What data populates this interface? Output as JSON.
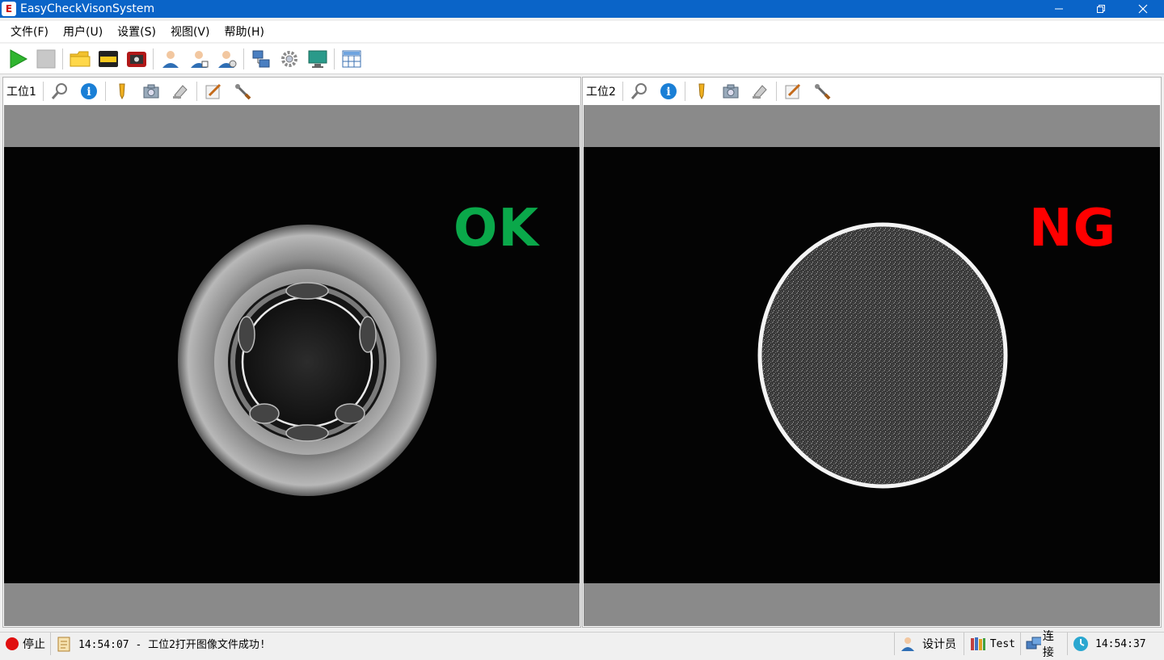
{
  "window": {
    "title": "EasyCheckVisonSystem",
    "logo_text": "E"
  },
  "menu": [
    {
      "label": "文件(F)"
    },
    {
      "label": "用户(U)"
    },
    {
      "label": "设置(S)"
    },
    {
      "label": "视图(V)"
    },
    {
      "label": "帮助(H)"
    }
  ],
  "toolbar": {
    "icons": [
      "play-icon",
      "stop-icon",
      "open-folder-icon",
      "save-icon",
      "camera-record-icon",
      "user-login-icon",
      "user-manage-icon",
      "user-settings-icon",
      "network-icon",
      "gear-icon",
      "monitor-icon",
      "grid-layout-icon"
    ]
  },
  "panels": [
    {
      "label": "工位1",
      "result": "OK",
      "result_color": "#0aa84a",
      "tools": [
        "zoom-icon",
        "info-icon",
        "pen-icon",
        "camera-icon",
        "stamp-icon",
        "edit-icon",
        "wrench-icon"
      ]
    },
    {
      "label": "工位2",
      "result": "NG",
      "result_color": "#ff0000",
      "tools": [
        "zoom-icon",
        "info-icon",
        "pen-icon",
        "camera-icon",
        "stamp-icon",
        "edit-icon",
        "wrench-icon"
      ]
    }
  ],
  "status": {
    "state": "停止",
    "state_color": "#e01010",
    "log": "14:54:07 - 工位2打开图像文件成功!",
    "role": "设计员",
    "project": "Test",
    "connection": "连接",
    "clock": "14:54:37"
  }
}
